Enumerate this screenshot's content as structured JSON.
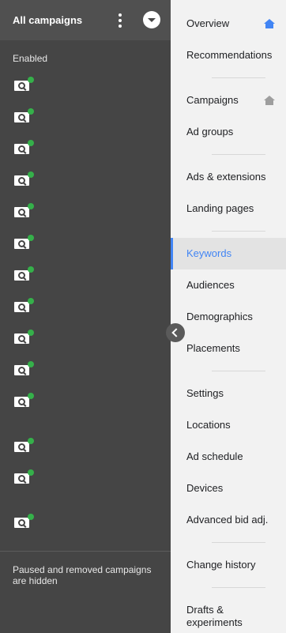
{
  "header": {
    "title": "All campaigns",
    "more_icon": "more-vert-icon",
    "dropdown_icon": "dropdown-icon"
  },
  "campaigns": {
    "section_label": "Enabled",
    "count": 14,
    "icon": "search-campaign-icon",
    "status_color": "#35b04a"
  },
  "footer_text": "Paused and removed campaigns are hidden",
  "collapse_icon": "chevron-left-icon",
  "nav": [
    {
      "label": "Overview",
      "icon": "home-icon"
    },
    {
      "label": "Recommendations"
    },
    {
      "label": "Campaigns",
      "icon": "home-icon"
    },
    {
      "label": "Ad groups"
    },
    {
      "label": "Ads & extensions"
    },
    {
      "label": "Landing pages"
    },
    {
      "label": "Keywords",
      "active": true
    },
    {
      "label": "Audiences"
    },
    {
      "label": "Demographics"
    },
    {
      "label": "Placements"
    },
    {
      "label": "Settings"
    },
    {
      "label": "Locations"
    },
    {
      "label": "Ad schedule"
    },
    {
      "label": "Devices"
    },
    {
      "label": "Advanced bid adj."
    },
    {
      "label": "Change history"
    },
    {
      "label": "Drafts & experiments"
    }
  ],
  "colors": {
    "accent": "#4285f4",
    "left_bg": "#454545",
    "right_bg": "#f2f2f2"
  }
}
